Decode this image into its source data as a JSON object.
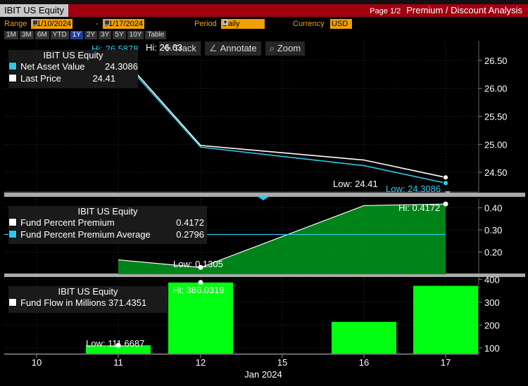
{
  "title": {
    "security": "IBIT US Equity",
    "page": "Page 1/2",
    "analysis": "Premium / Discount Analysis"
  },
  "controls": {
    "range_label": "Range",
    "range_start": "01/10/2024",
    "range_sep": "-",
    "range_end": "01/17/2024",
    "period_label": "Period",
    "period_value": "Daily",
    "currency_label": "Currency",
    "currency_value": "USD",
    "timeframes": [
      "1M",
      "3M",
      "6M",
      "YTD",
      "1Y",
      "2Y",
      "3Y",
      "5Y",
      "10Y",
      "Table"
    ],
    "selected_timeframe": "1Y"
  },
  "toolbar": {
    "track": "Track",
    "annotate": "Annotate",
    "zoom": "Zoom"
  },
  "colors": {
    "nav": "#2ec8e8",
    "last": "#ffffff",
    "premium_fill": "#008a1a",
    "premium_avg": "#2ec8e8",
    "flow": "#00ff10",
    "title_bar": "#a00010",
    "field": "#f0a000"
  },
  "chart_data": [
    {
      "type": "line",
      "legend_title": "IBIT US Equity",
      "x": [
        "11",
        "12",
        "16",
        "17"
      ],
      "series": [
        {
          "name": "Net Asset Value",
          "value_label": "24.3086",
          "values": [
            26.5878,
            24.95,
            24.62,
            24.3086
          ]
        },
        {
          "name": "Last Price",
          "value_label": "24.41",
          "values": [
            26.63,
            24.98,
            24.72,
            24.41
          ]
        }
      ],
      "ylim": [
        24.15,
        26.85
      ],
      "yticks": [
        "24.50",
        "25.00",
        "25.50",
        "26.00",
        "26.50"
      ],
      "annotations": {
        "hi_nav": "Hi: 26.5878",
        "hi_last": "Hi: 26.63",
        "low_last": "Low: 24.41",
        "low_nav": "Low: 24.3086"
      }
    },
    {
      "type": "area",
      "legend_title": "IBIT US Equity",
      "x": [
        "11",
        "12",
        "16",
        "17"
      ],
      "series": [
        {
          "name": "Fund Percent Premium",
          "value_label": "0.4172",
          "values": [
            0.165,
            0.1305,
            0.41,
            0.4172
          ]
        },
        {
          "name": "Fund Percent Premium Average",
          "value_label": "0.2796",
          "values": [
            0.2796,
            0.2796,
            0.2796,
            0.2796
          ]
        }
      ],
      "ylim": [
        0.1,
        0.44
      ],
      "yticks": [
        "0.20",
        "0.30",
        "0.40"
      ],
      "annotations": {
        "hi": "Hi: 0.4172",
        "low": "Low: 0.1305"
      }
    },
    {
      "type": "bar",
      "legend_title": "IBIT US Equity",
      "categories": [
        "11",
        "12",
        "16",
        "17"
      ],
      "series": [
        {
          "name": "Fund Flow in Millions",
          "value_label": "371.4351",
          "values": [
            111.6687,
            386.0319,
            214,
            371.4351
          ]
        }
      ],
      "ylim": [
        75,
        410
      ],
      "yticks": [
        "100",
        "200",
        "300",
        "400"
      ],
      "annotations": {
        "hi": "Hi: 386.0319",
        "low": "Low: 111.6687"
      }
    }
  ],
  "x_axis": {
    "ticks": [
      "10",
      "11",
      "12",
      "15",
      "16",
      "17"
    ],
    "label": "Jan 2024"
  }
}
